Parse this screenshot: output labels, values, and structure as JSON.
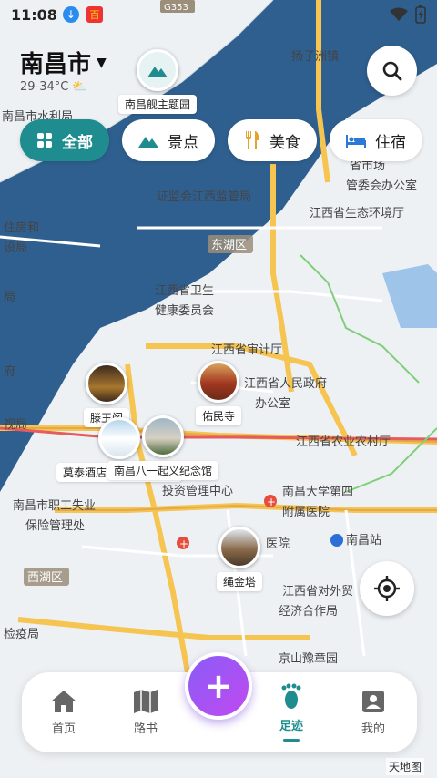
{
  "status_bar": {
    "time": "11:08",
    "app_icon_label": "百"
  },
  "header": {
    "city": "南昌市",
    "weather": "29-34°C"
  },
  "search_icon": "search-icon",
  "categories": [
    {
      "label": "全部",
      "icon": "grid-icon",
      "active": true
    },
    {
      "label": "景点",
      "icon": "mountain-icon",
      "active": false
    },
    {
      "label": "美食",
      "icon": "fork-knife-icon",
      "active": false
    },
    {
      "label": "住宿",
      "icon": "bed-icon",
      "active": false
    }
  ],
  "pois": [
    {
      "name": "南昌舰主题园"
    },
    {
      "name": "滕王阁"
    },
    {
      "name": "佑民寺"
    },
    {
      "name": "莫泰酒店(南昌滕王阁..."
    },
    {
      "name": "南昌八一起义纪念馆"
    },
    {
      "name": "绳金塔"
    }
  ],
  "map_labels": {
    "l1": "扬子洲镇",
    "l2": "南昌市水利局",
    "l3": "证监会江西监管局",
    "l4": "江西省生态环境厅",
    "l5": "东湖区",
    "l6": "江西省卫生",
    "l7": "健康委员会",
    "l8": "江西省审计厅",
    "l9": "江西省人民政府",
    "l10": "办公室",
    "l11": "江西省农业农村厅",
    "l12": "投资管理中心",
    "l13": "南昌大学第四",
    "l14": "附属医院",
    "l15": "南昌站",
    "l16": "南昌市职工失业",
    "l17": "保险管理处",
    "l18": "西湖区",
    "l19": "医院",
    "l20": "江西省对外贸",
    "l21": "经济合作局",
    "l22": "京山豫章园",
    "l23": "检疫局",
    "l24": "住房和",
    "l25": "设局",
    "l26": "局",
    "l27": "府",
    "l28": "视局",
    "l29": "省市场",
    "l30": "管委会办公室",
    "l31": "G353"
  },
  "nav": [
    {
      "label": "首页",
      "icon": "home-icon",
      "active": false
    },
    {
      "label": "路书",
      "icon": "map-book-icon",
      "active": false
    },
    {
      "label": "足迹",
      "icon": "footprint-icon",
      "active": true
    },
    {
      "label": "我的",
      "icon": "profile-icon",
      "active": false
    }
  ],
  "fab": {
    "symbol": "+"
  },
  "watermark": "天地图",
  "colors": {
    "accent": "#1f8d8f",
    "water": "#2f5f8f",
    "road_major": "#f6c451",
    "fab": "#9a50f2"
  }
}
